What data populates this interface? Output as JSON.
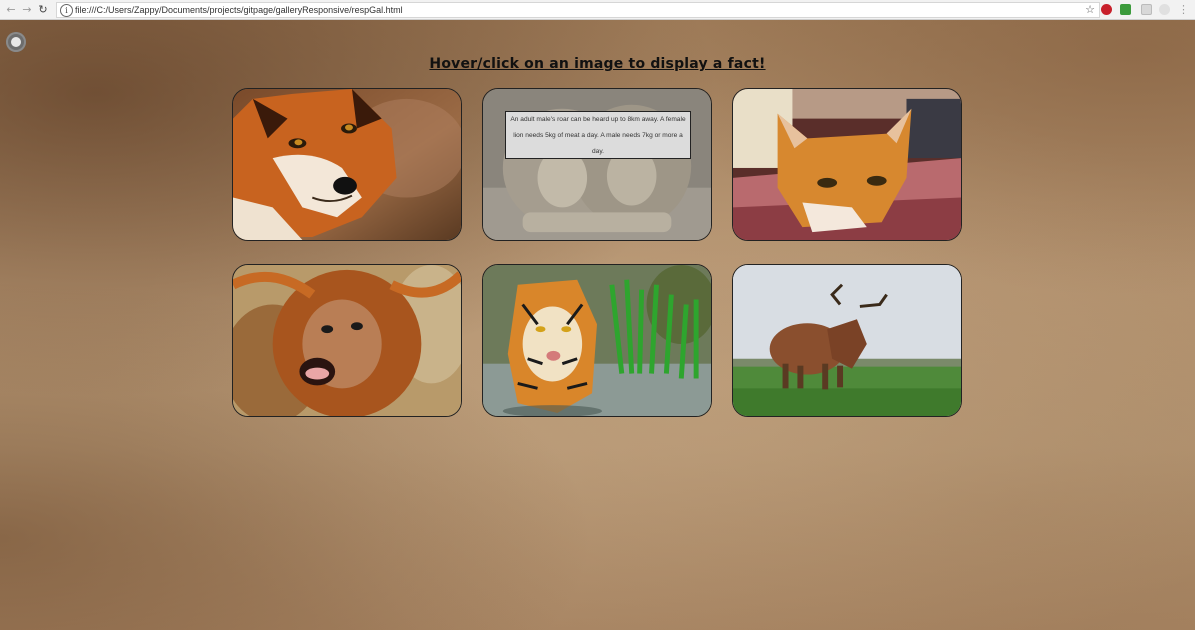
{
  "browser": {
    "url": "file:///C:/Users/Zappy/Documents/projects/gitpage/galleryResponsive/respGal.html",
    "back_icon": "arrow-left-icon",
    "forward_icon": "arrow-right-icon",
    "reload_icon": "reload-icon",
    "star_icon": "star-icon"
  },
  "page": {
    "heading": "Hover/click on an image to display a fact!"
  },
  "gallery": {
    "tiles": [
      {
        "subject": "fox-image"
      },
      {
        "subject": "lions-image",
        "fact": "An adult male's roar can be heard up to 8km away. A female lion needs 5kg of meat a day. A male needs 7kg or more a day."
      },
      {
        "subject": "cat-image"
      },
      {
        "subject": "orangutan-image"
      },
      {
        "subject": "tiger-image"
      },
      {
        "subject": "highland-cow-image"
      }
    ]
  },
  "colors": {
    "page_background": "#a98a6a",
    "heading": "#111111",
    "fact_box": "#dcdcdc"
  }
}
